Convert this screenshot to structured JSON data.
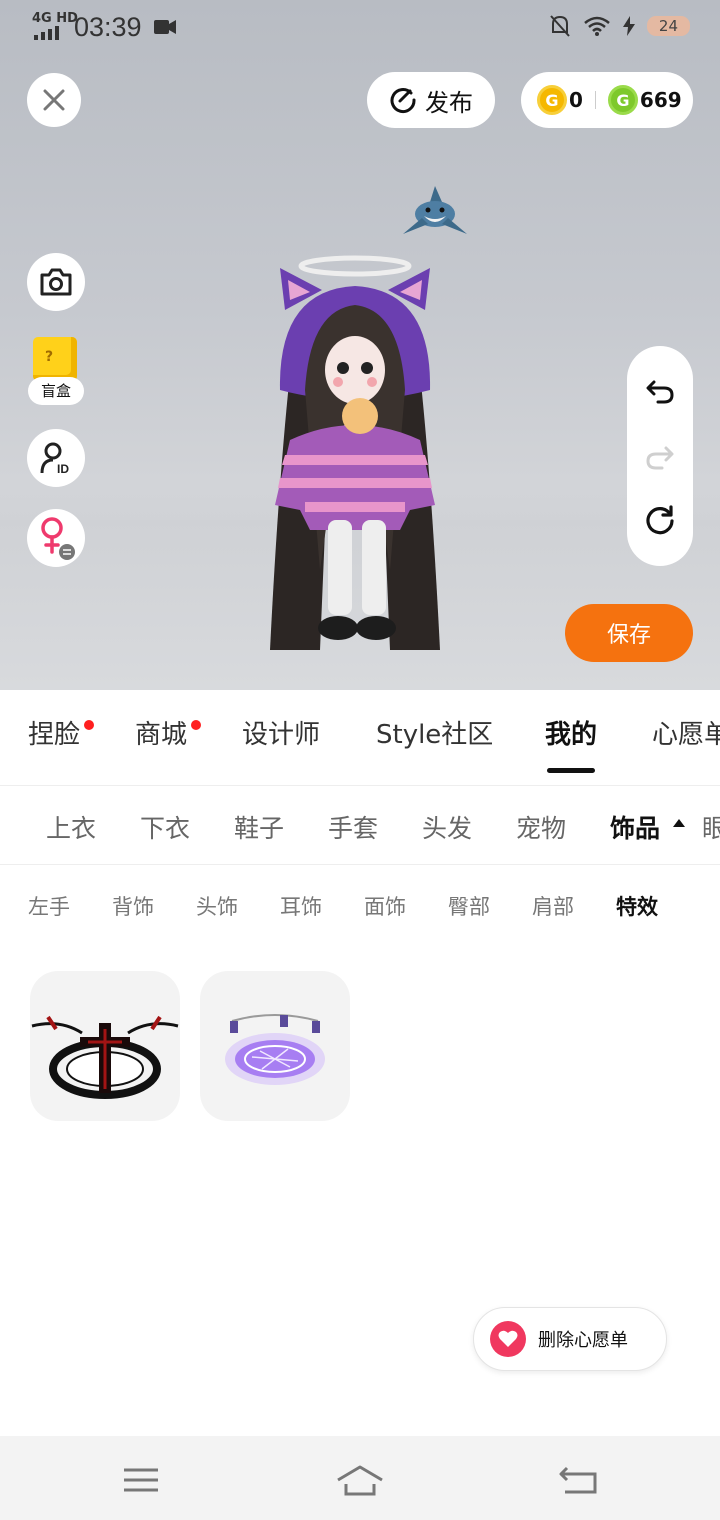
{
  "status_bar": {
    "network": "4G HD",
    "time": "03:39",
    "battery": "24"
  },
  "header": {
    "publish_label": "发布",
    "gold_coins": "0",
    "green_coins": "669"
  },
  "side_tools": {
    "blind_box_label": "盲盒"
  },
  "save_label": "保存",
  "main_tabs": [
    {
      "label": "捏脸",
      "dot": true
    },
    {
      "label": "商城",
      "dot": true
    },
    {
      "label": "设计师",
      "dot": false
    },
    {
      "label": "Style社区",
      "dot": false
    },
    {
      "label": "我的",
      "active": true
    },
    {
      "label": "心愿单",
      "dot": false
    }
  ],
  "categories": [
    {
      "label": "上衣"
    },
    {
      "label": "下衣"
    },
    {
      "label": "鞋子"
    },
    {
      "label": "手套"
    },
    {
      "label": "头发"
    },
    {
      "label": "宠物"
    },
    {
      "label": "饰品",
      "active": true
    },
    {
      "label": "眼镜"
    }
  ],
  "subcategories": [
    {
      "label": "左手"
    },
    {
      "label": "背饰"
    },
    {
      "label": "头饰"
    },
    {
      "label": "耳饰"
    },
    {
      "label": "面饰"
    },
    {
      "label": "臀部"
    },
    {
      "label": "肩部"
    },
    {
      "label": "特效",
      "active": true
    }
  ],
  "items": [
    {
      "name": "dark-cross-effect"
    },
    {
      "name": "purple-magic-circle-effect"
    }
  ],
  "wishlist_button": "删除心愿单",
  "colors": {
    "accent_orange": "#f5720f",
    "tab_dot_red": "#ff1f1f",
    "heart_pink": "#f0385f",
    "gold_coin": "#f5b800",
    "green_coin": "#7ec92b"
  }
}
